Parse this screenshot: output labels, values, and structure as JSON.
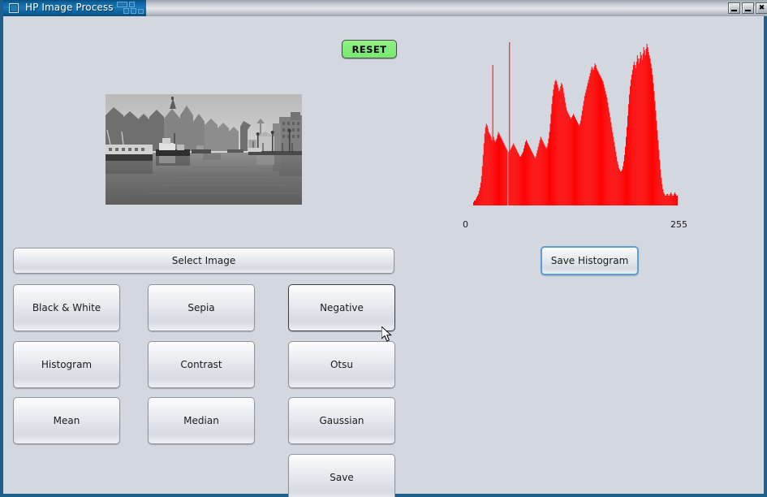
{
  "window": {
    "title": "HP Image Process",
    "icon": "app-window-icon",
    "controls": [
      {
        "name": "minimize",
        "glyph": "minimize-icon"
      },
      {
        "name": "maximize",
        "glyph": "maximize-icon"
      },
      {
        "name": "close",
        "glyph": "close-icon",
        "label": "✖"
      }
    ]
  },
  "toolbar": {
    "reset_label": "RESET",
    "reset_color": "#82ec78"
  },
  "preview": {
    "alt": "grayscale photograph of a riverside city waterfront with moored boats, historic gabled houses on the left bank and a large warehouse block on the right bank"
  },
  "buttons": {
    "select_image": "Select Image",
    "black_and_white": "Black & White",
    "sepia": "Sepia",
    "negative": "Negative",
    "histogram": "Histogram",
    "contrast": "Contrast",
    "otsu": "Otsu",
    "mean": "Mean",
    "median": "Median",
    "gaussian": "Gaussian",
    "save": "Save",
    "save_histogram": "Save Histogram"
  },
  "chart_data": {
    "type": "bar",
    "title": "",
    "xlabel": "",
    "ylabel": "",
    "series_color": "#FF0000",
    "background": "#d3d7df",
    "grid": false,
    "legend": null,
    "axis_labels": {
      "min": "0",
      "max": "255"
    },
    "xlim": [
      0,
      255
    ],
    "ylim": [
      0,
      100
    ],
    "categories_note": "pixel intensity bins 0-255",
    "values": [
      2,
      3,
      3,
      4,
      5,
      6,
      7,
      9,
      11,
      14,
      18,
      24,
      31,
      38,
      44,
      48,
      50,
      49,
      47,
      45,
      44,
      43,
      42,
      40,
      86,
      42,
      40,
      39,
      40,
      41,
      43,
      45,
      44,
      43,
      42,
      41,
      40,
      39,
      38,
      37,
      36,
      35,
      34,
      0,
      33,
      100,
      34,
      35,
      36,
      37,
      38,
      37,
      36,
      35,
      34,
      33,
      32,
      31,
      30,
      30,
      31,
      32,
      33,
      35,
      37,
      39,
      40,
      39,
      38,
      37,
      36,
      35,
      34,
      33,
      32,
      31,
      30,
      29,
      30,
      32,
      34,
      36,
      38,
      40,
      42,
      41,
      40,
      39,
      38,
      37,
      36,
      35,
      36,
      38,
      41,
      45,
      50,
      56,
      62,
      67,
      71,
      74,
      76,
      77,
      76,
      74,
      72,
      70,
      71,
      73,
      75,
      74,
      72,
      69,
      66,
      63,
      60,
      58,
      57,
      56,
      55,
      54,
      53,
      54,
      55,
      56,
      55,
      54,
      53,
      52,
      51,
      50,
      49,
      50,
      52,
      55,
      58,
      61,
      64,
      67,
      69,
      71,
      73,
      75,
      77,
      79,
      81,
      83,
      85,
      84,
      83,
      85,
      87,
      86,
      84,
      83,
      82,
      81,
      80,
      79,
      78,
      77,
      76,
      74,
      72,
      70,
      68,
      66,
      63,
      60,
      57,
      54,
      51,
      48,
      45,
      42,
      39,
      36,
      33,
      30,
      27,
      25,
      23,
      22,
      21,
      21,
      22,
      24,
      27,
      31,
      36,
      42,
      48,
      55,
      62,
      68,
      73,
      77,
      80,
      83,
      86,
      88,
      86,
      84,
      88,
      92,
      90,
      87,
      90,
      94,
      92,
      89,
      93,
      97,
      95,
      92,
      96,
      99,
      97,
      94,
      92,
      90,
      87,
      84,
      80,
      75,
      70,
      64,
      58,
      52,
      46,
      40,
      34,
      28,
      22,
      17,
      13,
      10,
      8,
      7,
      6,
      6,
      7,
      7,
      6,
      6,
      7,
      8,
      7,
      6,
      6,
      7,
      8,
      7,
      6,
      6
    ]
  }
}
